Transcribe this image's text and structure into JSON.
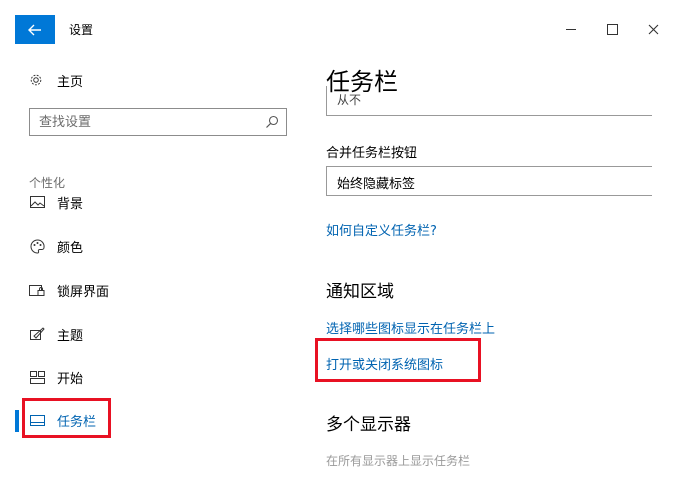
{
  "titlebar": {
    "back_icon": "arrow-left-icon",
    "title": "设置",
    "accent": "#0078d7"
  },
  "sidebar": {
    "home_label": "主页",
    "search_placeholder": "查找设置",
    "section_label": "个性化",
    "items": [
      {
        "label": "背景",
        "icon": "picture-icon"
      },
      {
        "label": "颜色",
        "icon": "palette-icon"
      },
      {
        "label": "锁屏界面",
        "icon": "lock-screen-icon"
      },
      {
        "label": "主题",
        "icon": "theme-brush-icon"
      },
      {
        "label": "开始",
        "icon": "start-menu-icon"
      },
      {
        "label": "任务栏",
        "icon": "taskbar-icon",
        "active": true
      }
    ]
  },
  "main": {
    "page_title": "任务栏",
    "cut_dropdown_value": "从不",
    "combine_label": "合并任务栏按钮",
    "combine_value": "始终隐藏标签",
    "customize_link": "如何自定义任务栏?",
    "notify_heading": "通知区域",
    "select_icons_link": "选择哪些图标显示在任务栏上",
    "system_icons_link": "打开或关闭系统图标",
    "multi_heading": "多个显示器",
    "multi_text": "在所有显示器上显示任务栏"
  },
  "colors": {
    "link": "#0063b1",
    "highlight": "#e81123"
  }
}
